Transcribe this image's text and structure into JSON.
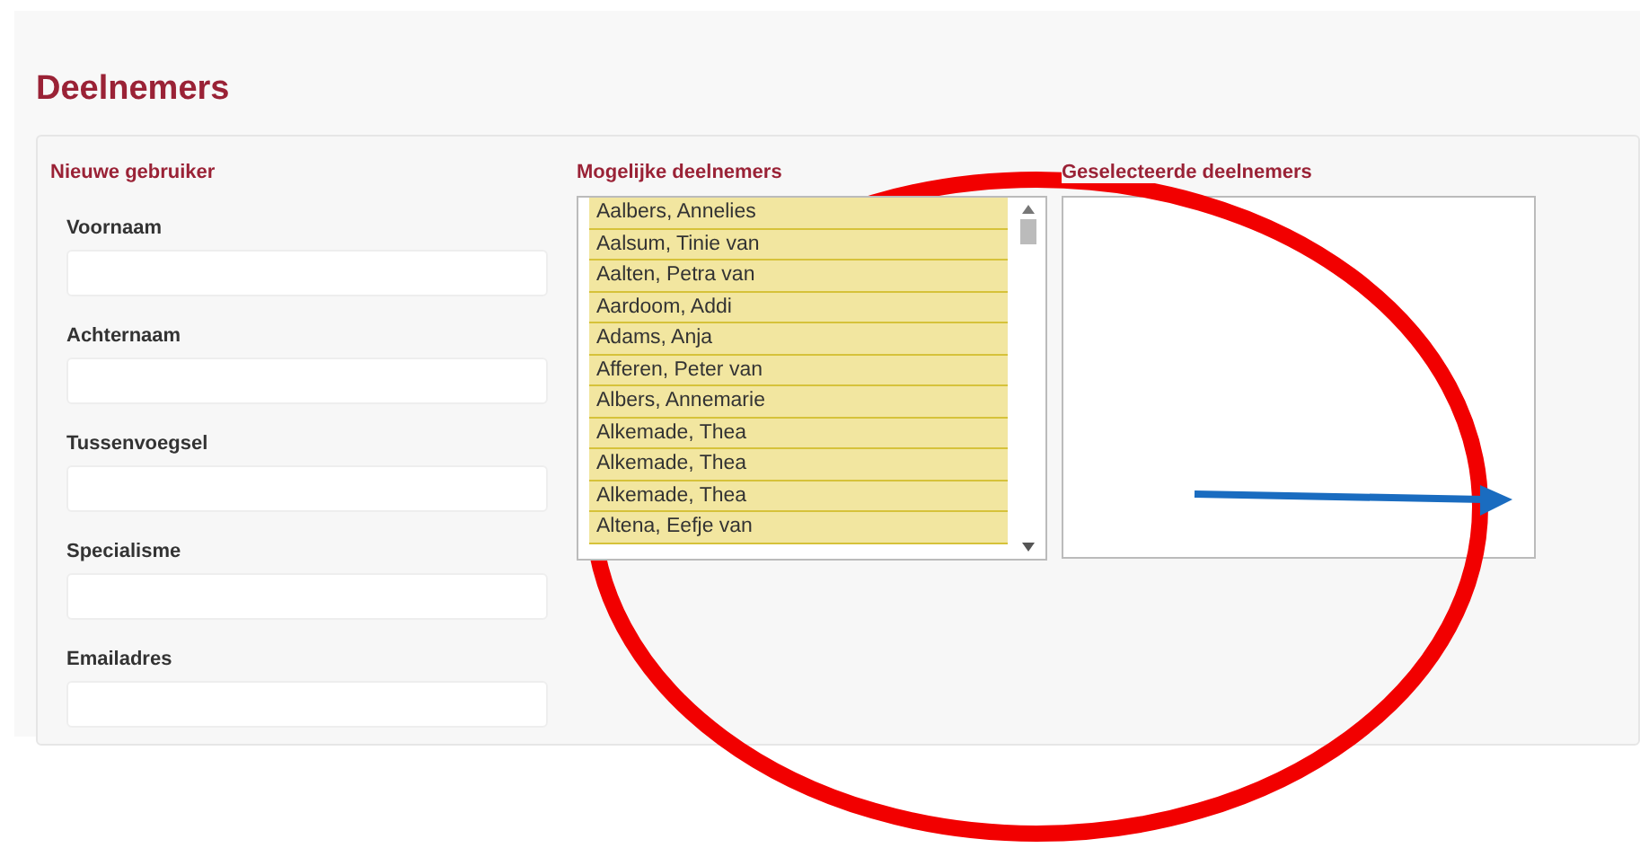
{
  "title": "Deelnemers",
  "new_user": {
    "heading": "Nieuwe gebruiker",
    "fields": [
      {
        "label": "Voornaam"
      },
      {
        "label": "Achternaam"
      },
      {
        "label": "Tussenvoegsel"
      },
      {
        "label": "Specialisme"
      },
      {
        "label": "Emailadres"
      }
    ]
  },
  "available": {
    "heading": "Mogelijke deelnemers",
    "items": [
      "Aalbers, Annelies",
      "Aalsum, Tinie van",
      "Aalten, Petra van",
      "Aardoom, Addi",
      "Adams, Anja",
      "Afferen, Peter van",
      "Albers, Annemarie",
      "Alkemade, Thea",
      "Alkemade, Thea",
      "Alkemade, Thea",
      "Altena, Eefje van"
    ]
  },
  "selected": {
    "heading": "Geselecteerde deelnemers"
  }
}
